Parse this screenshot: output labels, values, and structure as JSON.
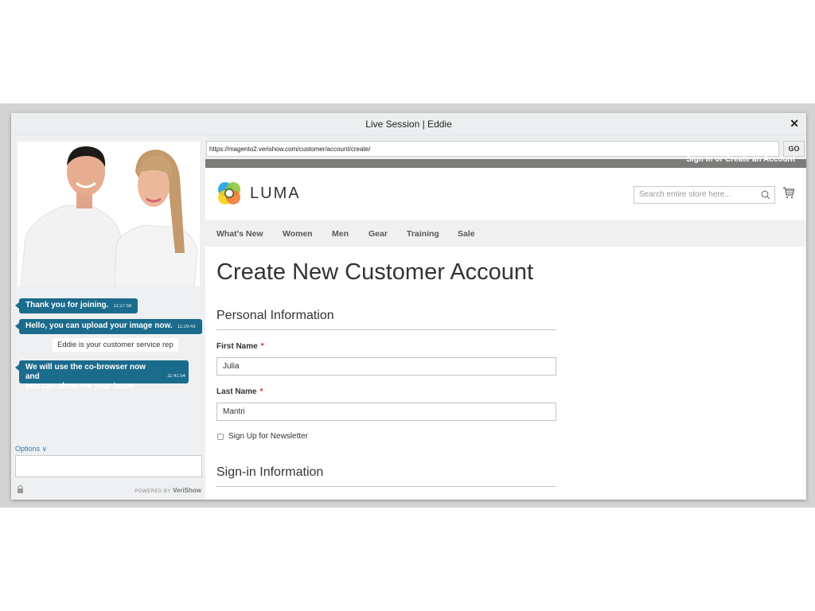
{
  "window": {
    "title": "Live Session | Eddie",
    "close_icon": "close-icon"
  },
  "chat": {
    "messages": [
      {
        "text": "Thank you for joining.",
        "time": "11:27:59",
        "type": "agent"
      },
      {
        "text": "Hello, you can upload your image now.",
        "time": "11:29:43",
        "type": "agent"
      },
      {
        "text": "Eddie  is your customer service rep",
        "type": "system"
      },
      {
        "text_line1": "We will use the co-browser now and",
        "text_line2": "you can show me your issue",
        "time": "11:41:54",
        "type": "agent"
      }
    ],
    "options_label": "Options ∨",
    "input_value": "",
    "powered_prefix": "POWERED BY",
    "powered_brand": "VeriShow",
    "accent_color": "#1b6b8c"
  },
  "browser": {
    "url": "https://magento2.verishow.com/customer/account/create/",
    "go_label": "GO",
    "top_links": "Sign In  or  Create an Account"
  },
  "store": {
    "logo_text": "LUMA",
    "search_placeholder": "Search entire store here...",
    "nav": [
      "What's New",
      "Women",
      "Men",
      "Gear",
      "Training",
      "Sale"
    ],
    "page_title": "Create New Customer Account",
    "section_personal": "Personal Information",
    "first_name_label": "First Name",
    "first_name_value": "Julia",
    "last_name_label": "Last Name",
    "last_name_value": "Mantri",
    "required_mark": "*",
    "newsletter_label": "Sign Up for Newsletter",
    "newsletter_checked": false,
    "section_signin": "Sign-in Information"
  }
}
